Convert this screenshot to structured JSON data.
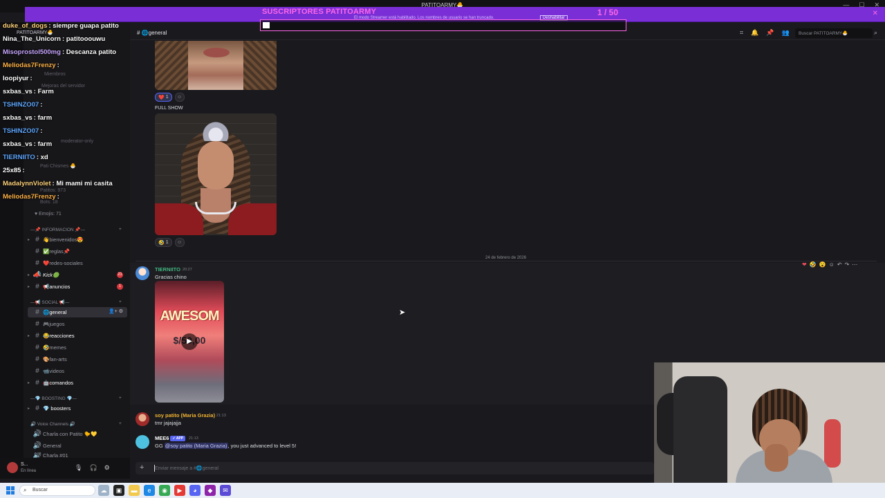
{
  "window": {
    "title": "PATITOARMY🐣"
  },
  "goal": {
    "title": "SUSCRIPTORES PATITOARMY",
    "count": "1 / 50",
    "current": 1,
    "target": 50,
    "notice": "El modo Streamer está habilitado. Los nombres de usuario se han truncado.",
    "notice_button": "Deshabilitar"
  },
  "server": {
    "name": "PATITOARMY🐣"
  },
  "sidebar_ghost": {
    "members": "Miembros",
    "boost": "Mejoras del servidor",
    "moderator": "moderator-only",
    "chismes": "Pati Chismes 🐣",
    "patitos": "Patitos: 973",
    "bots": "Bots: 18",
    "emojis": "♥ Emojis: 71"
  },
  "categories": [
    {
      "label": "—📌 INFORMACION 📌—"
    },
    {
      "label": "—📢 SOCIAL 📢—"
    },
    {
      "label": "—💎 BOOSTING 💎—"
    },
    {
      "label": "🔊 Voice Channels 🔊"
    }
  ],
  "channels": [
    {
      "name": "👋bienvenidos😍",
      "badge": ""
    },
    {
      "name": "✅reglas📌",
      "badge": ""
    },
    {
      "name": "❤️redes-sociales",
      "badge": ""
    },
    {
      "name": "Kick🟢",
      "badge": "21"
    },
    {
      "name": "📢anuncios",
      "badge": "1"
    },
    {
      "name": "🌐general",
      "badge": ""
    },
    {
      "name": "🎮juegos",
      "badge": ""
    },
    {
      "name": "😂reacciones",
      "badge": ""
    },
    {
      "name": "🤣memes",
      "badge": ""
    },
    {
      "name": "🎨fan-arts",
      "badge": ""
    },
    {
      "name": "📹videos",
      "badge": ""
    },
    {
      "name": "🤖comandos",
      "badge": ""
    },
    {
      "name": "💎 boosters",
      "badge": ""
    },
    {
      "name": "Charla con Patito 🐤💛",
      "badge": ""
    },
    {
      "name": "General",
      "badge": ""
    },
    {
      "name": "Charla #01",
      "badge": ""
    }
  ],
  "user_panel": {
    "name": "S...",
    "status": "En línea"
  },
  "stream_chat": [
    {
      "user": "duke_of_dogs",
      "text": ": siempre guapa patito",
      "color": "#ffd27a"
    },
    {
      "user": "Nina_The_Unicorn",
      "text": ": patitooouwu",
      "color": "#ffffff"
    },
    {
      "user": "Misoprostol500mg",
      "text": ": Descanza patito",
      "color": "#c9a7ff"
    },
    {
      "user": "Meliodas7Frenzy",
      "text": ":",
      "color": "#ffb347"
    },
    {
      "user": "loopiyur",
      "text": ":",
      "color": "#ffffff"
    },
    {
      "user": "sxbas_vs",
      "text": ": Farm",
      "color": "#ffffff"
    },
    {
      "user": "TSHINZO07",
      "text": ":",
      "color": "#5fa8ff"
    },
    {
      "user": "sxbas_vs",
      "text": ": farm",
      "color": "#ffffff"
    },
    {
      "user": "TSHINZO07",
      "text": ":",
      "color": "#5fa8ff"
    },
    {
      "user": "sxbas_vs",
      "text": ": farm",
      "color": "#ffffff"
    },
    {
      "user": "TIERNIITO",
      "text": ": xd",
      "color": "#5fa8ff"
    },
    {
      "user": "25x85",
      "text": ":",
      "color": "#ffffff"
    },
    {
      "user": "MadalynnViolet",
      "text": ": Mi mami mi casita",
      "color": "#ffd27a"
    },
    {
      "user": "Meliodas7Frenzy",
      "text": ":",
      "color": "#ffb347"
    }
  ],
  "header": {
    "channel": "🌐general",
    "search_placeholder": "Buscar PATITOARMY🐣"
  },
  "messages": {
    "first_reaction": {
      "emoji": "❤️",
      "count": "1"
    },
    "full_show": "FULL SHOW",
    "second_reaction": {
      "emoji": "🤣",
      "count": "1"
    },
    "date_divider": "24 de febrero de 2026",
    "m1": {
      "author": "TIERNIITO",
      "time": "20:27",
      "text": "Gracias chino",
      "video_title": "AWESOM",
      "video_sub": "$/50,00"
    },
    "m2": {
      "author": "soy patito (Maria Grazia)",
      "time": "21:13",
      "text": "tmr jajajajja"
    },
    "m3": {
      "author": "MEE6",
      "badge": "✓ APP",
      "time": "21:13",
      "prefix": "GG ",
      "mention": "@soy patito (Maria Grazia)",
      "suffix": ", you just advanced to level 5!"
    }
  },
  "composer": {
    "placeholder": "Enviar mensaje a #🌐general"
  },
  "taskbar": {
    "search": "Buscar"
  },
  "colors": {
    "accent": "#5865f2",
    "goal_bar": "#7a2fd6",
    "goal_text": "#ff66e8",
    "author_tierniito": "#43b581",
    "author_patito": "#f0b232"
  }
}
